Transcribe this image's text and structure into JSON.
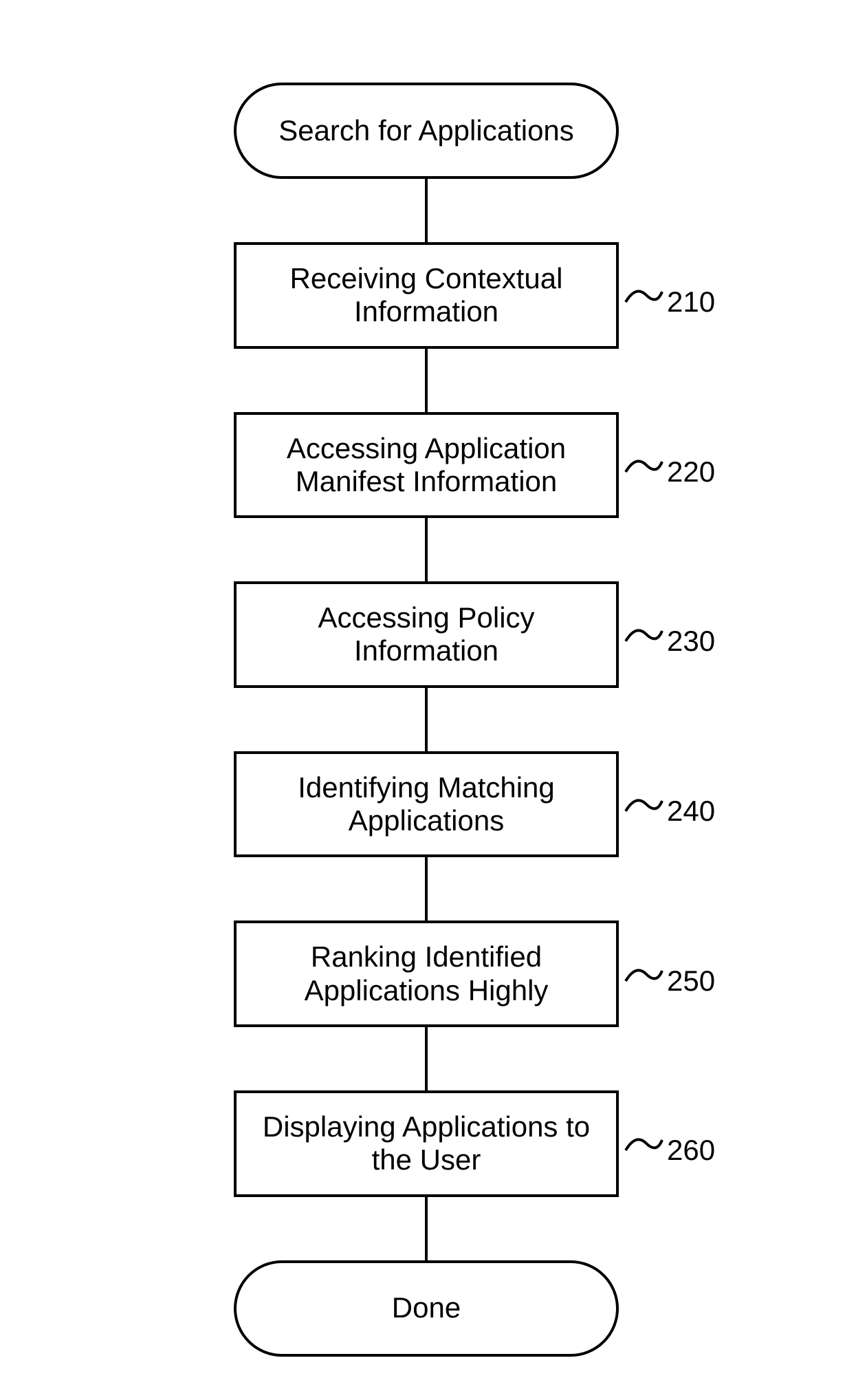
{
  "flowchart": {
    "start": "Search for Applications",
    "end": "Done",
    "steps": [
      {
        "text": "Receiving Contextual Information",
        "ref": "210"
      },
      {
        "text": "Accessing Application Manifest Information",
        "ref": "220"
      },
      {
        "text": "Accessing Policy Information",
        "ref": "230"
      },
      {
        "text": "Identifying Matching Applications",
        "ref": "240"
      },
      {
        "text": "Ranking Identified Applications Highly",
        "ref": "250"
      },
      {
        "text": "Displaying Applications to the User",
        "ref": "260"
      }
    ]
  }
}
